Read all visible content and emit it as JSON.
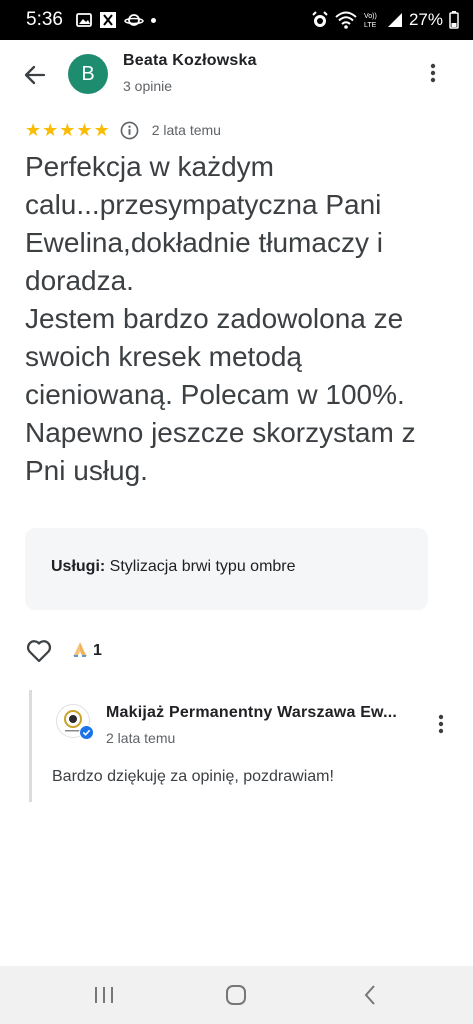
{
  "status_bar": {
    "time": "5:36",
    "battery": "27%"
  },
  "header": {
    "avatar_letter": "B",
    "author_name": "Beata Kozłowska",
    "author_reviews": "3 opinie"
  },
  "review": {
    "rating": 5,
    "date": "2 lata temu",
    "text_line1": "Perfekcja w każdym calu...przesympatyczna Pani Ewelina,dokładnie tłumaczy i doradza.",
    "text_line2": "Jestem bardzo zadowolona ze swoich kresek metodą cieniowaną. Polecam w 100%. Napewno jeszcze skorzystam z Pni usług.",
    "services_label": "Usługi:",
    "services_value": "Stylizacja brwi typu ombre",
    "reaction_count": "1"
  },
  "owner_reply": {
    "name": "Makijaż Permanentny Warszawa Ew...",
    "date": "2 lata temu",
    "text": "Bardzo dziękuję za opinię, pozdrawiam!"
  },
  "colors": {
    "avatar_bg": "#1e8c6f",
    "star": "#fbbc04",
    "verified": "#1a73e8"
  }
}
